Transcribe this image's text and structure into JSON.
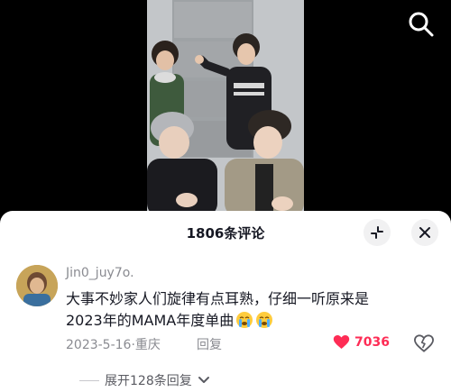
{
  "comments_panel": {
    "title": "1806条评论",
    "comment": {
      "username": "Jin0_juy7o.",
      "text_line1": "大事不妙家人们旋律有点耳熟，仔细一听原来是",
      "text_line2": "2023年的MAMA年度单曲",
      "date": "2023-5-16",
      "location": "重庆",
      "reply_label": "回复",
      "like_count": "7036",
      "expand_label": "展开128条回复"
    }
  },
  "colors": {
    "like": "#fe2c55",
    "text": "#161823",
    "muted": "#8a8b91"
  },
  "icons": [
    "search-icon",
    "collapse-icon",
    "close-icon",
    "heart-icon",
    "dislike-icon",
    "chevron-down-icon",
    "crying-emoji-icon"
  ]
}
